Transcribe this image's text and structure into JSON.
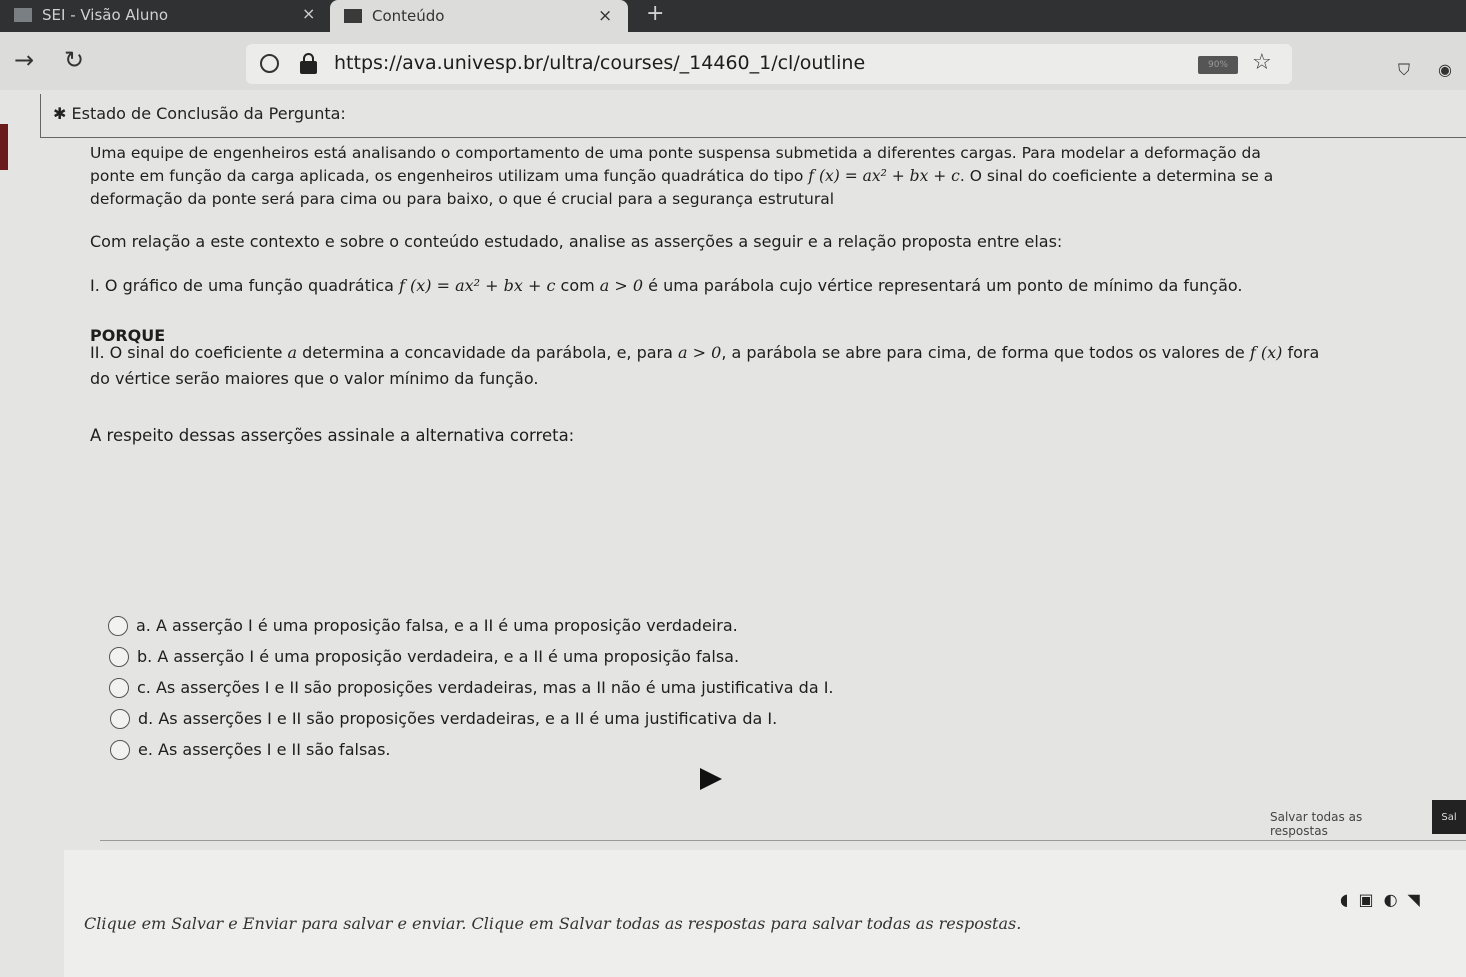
{
  "browser": {
    "tabs": [
      {
        "label": "SEI - Visão Aluno",
        "close": "×"
      },
      {
        "label": "Conteúdo",
        "close": "×"
      }
    ],
    "new_tab": "+",
    "url": "https://ava.univesp.br/ultra/courses/_14460_1/cl/outline",
    "zoom": "90%",
    "icons": {
      "back": "arrow-right-icon",
      "reload": "reload-icon",
      "star": "star-icon",
      "shield": "shield-icon",
      "menu": "account-icon"
    }
  },
  "question": {
    "status_label": "✱ Estado de Conclusão da Pergunta:",
    "para1_line1": "Uma equipe de engenheiros está analisando o comportamento de uma ponte suspensa submetida a diferentes cargas. Para modelar a deformação da",
    "para1_line2_a": "ponte em função da carga aplicada, os engenheiros utilizam uma função quadrática do tipo ",
    "formula": "f (x) = ax² + bx + c",
    "para1_line2_b": ". O sinal do coeficiente a determina se a",
    "para1_line3": "deformação da ponte será para cima ou para baixo, o que é crucial para a segurança estrutural",
    "para2": "Com relação a este contexto e sobre o conteúdo estudado, analise as asserções a seguir e a relação proposta entre elas:",
    "assertion1_a": "I. O gráfico de uma função quadrática ",
    "assertion1_b": " com ",
    "assertion1_cond": "a > 0",
    "assertion1_c": " é uma parábola cujo vértice representará um ponto de mínimo da função.",
    "porque": "PORQUE",
    "assertion2_line1_a": "II. O sinal do coeficiente ",
    "assertion2_var": "a",
    "assertion2_line1_b": " determina a concavidade da parábola, e, para ",
    "assertion2_cond": "a > 0",
    "assertion2_line1_c": ", a parábola se abre para cima, de forma que todos os valores de ",
    "assertion2_fx": "f (x)",
    "assertion2_line1_d": "  fora",
    "assertion2_line2": "do vértice serão maiores que o valor mínimo da função.",
    "instruction": "A respeito dessas asserções assinale a alternativa correta:"
  },
  "options": [
    "a. A asserção I é uma proposição falsa, e a II é uma proposição verdadeira.",
    "b. A asserção I é uma proposição verdadeira, e a II é uma proposição falsa.",
    "c. As asserções I e II são proposições verdadeiras, mas a II não é uma justificativa da I.",
    "d. As asserções I e II são proposições verdadeiras, e a II é uma justificativa da I.",
    "e. As asserções I e II são falsas."
  ],
  "footer": {
    "save_all": "Salvar todas as respostas",
    "save_submit": "Sal",
    "text": "Clique em Salvar e Enviar para salvar e enviar. Clique em Salvar todas as respostas para salvar todas as respostas."
  }
}
